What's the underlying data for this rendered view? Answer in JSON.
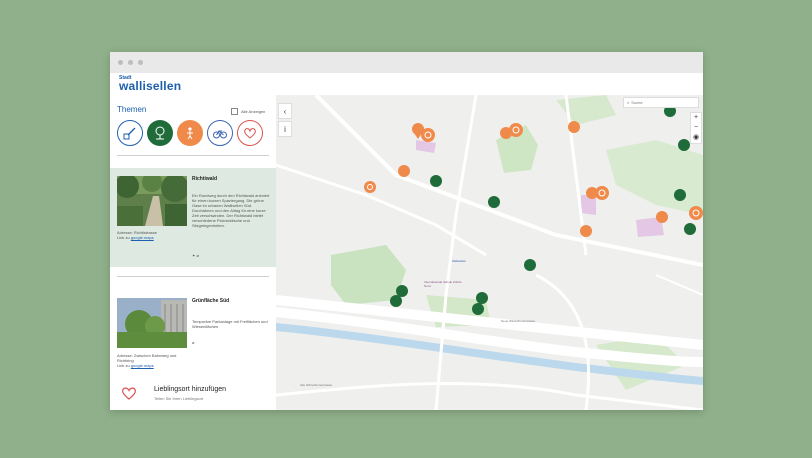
{
  "brand": {
    "small": "Stadt",
    "name": "wallisellen"
  },
  "sidebar": {
    "themen_title": "Themen",
    "alle_anzeigen": "Alle Anzeigen",
    "theme_icons": [
      {
        "icon": "pencil-square-icon",
        "color": "#1d5fae",
        "filled": false
      },
      {
        "icon": "tree-icon",
        "color": "#1f6b3a",
        "filled": true
      },
      {
        "icon": "playground-icon",
        "color": "#f08a4b",
        "filled": true
      },
      {
        "icon": "bicycle-icon",
        "color": "#3b63b5",
        "filled": false
      },
      {
        "icon": "heart-icon",
        "color": "#d9534f",
        "filled": false
      }
    ]
  },
  "card1": {
    "title": "Richtiwald",
    "text": "Ein Rundweg durch den Richtiwald animiert für einen kurzen Spaziergang. Die grüne Oase im urbanen Wallisellen Süd. Durchatmen und den Alltag für eine kurze Zeit verschwinden. Der Richtiwald bietet verschiedene Picknicktische und Sitzgelegenheiten.",
    "address": "Adresse: Richtistrasse",
    "link_prefix": "Link zu",
    "link": "google.maps",
    "icons": "✦ ⌀"
  },
  "card2": {
    "title": "Grünfläche Süd",
    "text": "Temporäre Parkanlage mit Freiflächen und Wiesenflächen",
    "address": "Adresse: Zwischen Bahnweg und Richtiring",
    "link_prefix": "Link zu",
    "link": "google.maps",
    "icons": "⌀"
  },
  "favorite": {
    "title": "Lieblingsort hinzufügen",
    "subtitle": "Teilen Sie Ihren Lieblingsort"
  },
  "map": {
    "search_placeholder": "Suche",
    "zoom_in": "+",
    "zoom_out": "−",
    "labels": {
      "station": "Wallisellen",
      "poi": "Internationale Schule Zürich-Nord",
      "street1": "Neue Winterthurerstrasse",
      "street2": "Alte Winterthurerstrasse"
    }
  },
  "colors": {
    "brand": "#1d5fae",
    "nature": "#1f6b3a",
    "play": "#f08a4b",
    "panel": "#dde9e1",
    "background": "#8fb08a"
  }
}
